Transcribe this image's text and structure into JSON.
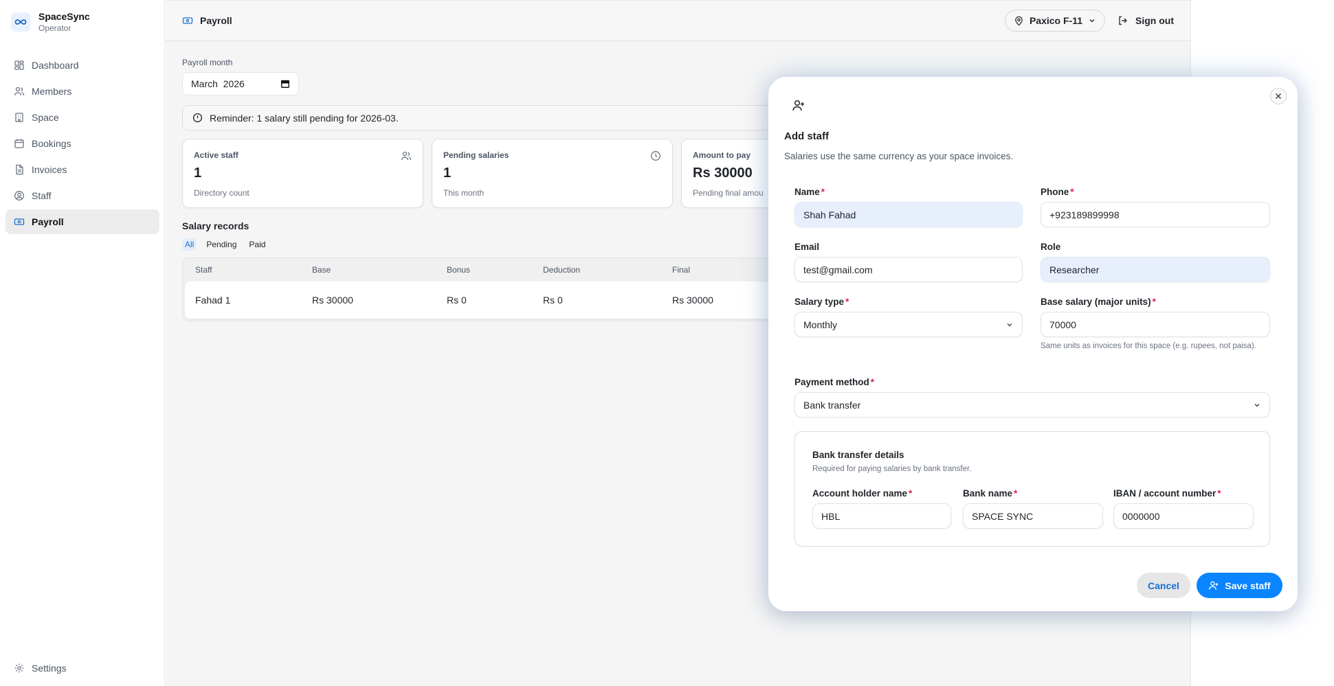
{
  "brand": {
    "name": "SpaceSync",
    "role": "Operator"
  },
  "sidebar": {
    "items": [
      {
        "label": "Dashboard",
        "icon": "dashboard-icon"
      },
      {
        "label": "Members",
        "icon": "users-icon"
      },
      {
        "label": "Space",
        "icon": "building-icon"
      },
      {
        "label": "Bookings",
        "icon": "calendar-icon"
      },
      {
        "label": "Invoices",
        "icon": "file-icon"
      },
      {
        "label": "Staff",
        "icon": "user-circle-icon"
      },
      {
        "label": "Payroll",
        "icon": "banknote-icon",
        "active": true
      }
    ],
    "settings_label": "Settings"
  },
  "topbar": {
    "title": "Payroll",
    "location": "Paxico F-11",
    "signout": "Sign out"
  },
  "payroll": {
    "month_label": "Payroll month",
    "month_value": "March  2026",
    "reminder": "Reminder: 1 salary still pending for 2026-03.",
    "cards": [
      {
        "title": "Active staff",
        "value": "1",
        "sub": "Directory count",
        "icon": "users-icon"
      },
      {
        "title": "Pending salaries",
        "value": "1",
        "sub": "This month",
        "icon": "clock-icon"
      },
      {
        "title": "Amount to pay",
        "value": "Rs 30000",
        "sub": "Pending final amou"
      }
    ],
    "records_title": "Salary records",
    "filters": [
      "All",
      "Pending",
      "Paid"
    ],
    "columns": [
      "Staff",
      "Base",
      "Bonus",
      "Deduction",
      "Final"
    ],
    "rows": [
      [
        "Fahad 1",
        "Rs 30000",
        "Rs 0",
        "Rs 0",
        "Rs 30000"
      ]
    ]
  },
  "modal": {
    "title": "Add staff",
    "description": "Salaries use the same currency as your space invoices.",
    "name": {
      "label": "Name",
      "value": "Shah Fahad"
    },
    "phone": {
      "label": "Phone",
      "value": "+923189899998"
    },
    "email": {
      "label": "Email",
      "value": "test@gmail.com"
    },
    "role": {
      "label": "Role",
      "value": "Researcher"
    },
    "salary_type": {
      "label": "Salary type",
      "value": "Monthly"
    },
    "base_salary": {
      "label": "Base salary (major units)",
      "value": "70000",
      "hint": "Same units as invoices for this space (e.g. rupees, not paisa)."
    },
    "payment_method": {
      "label": "Payment method",
      "value": "Bank transfer"
    },
    "bank": {
      "title": "Bank transfer details",
      "subtitle": "Required for paying salaries by bank transfer.",
      "holder": {
        "label": "Account holder name",
        "value": "HBL"
      },
      "bank_name": {
        "label": "Bank name",
        "value": "SPACE SYNC"
      },
      "iban": {
        "label": "IBAN / account number",
        "value": "0000000"
      }
    },
    "cancel": "Cancel",
    "save": "Save staff"
  },
  "colors": {
    "accent": "#0a84ff",
    "required": "#e11d48",
    "active_nav": "#ececec",
    "filled_input": "#e8effc"
  }
}
